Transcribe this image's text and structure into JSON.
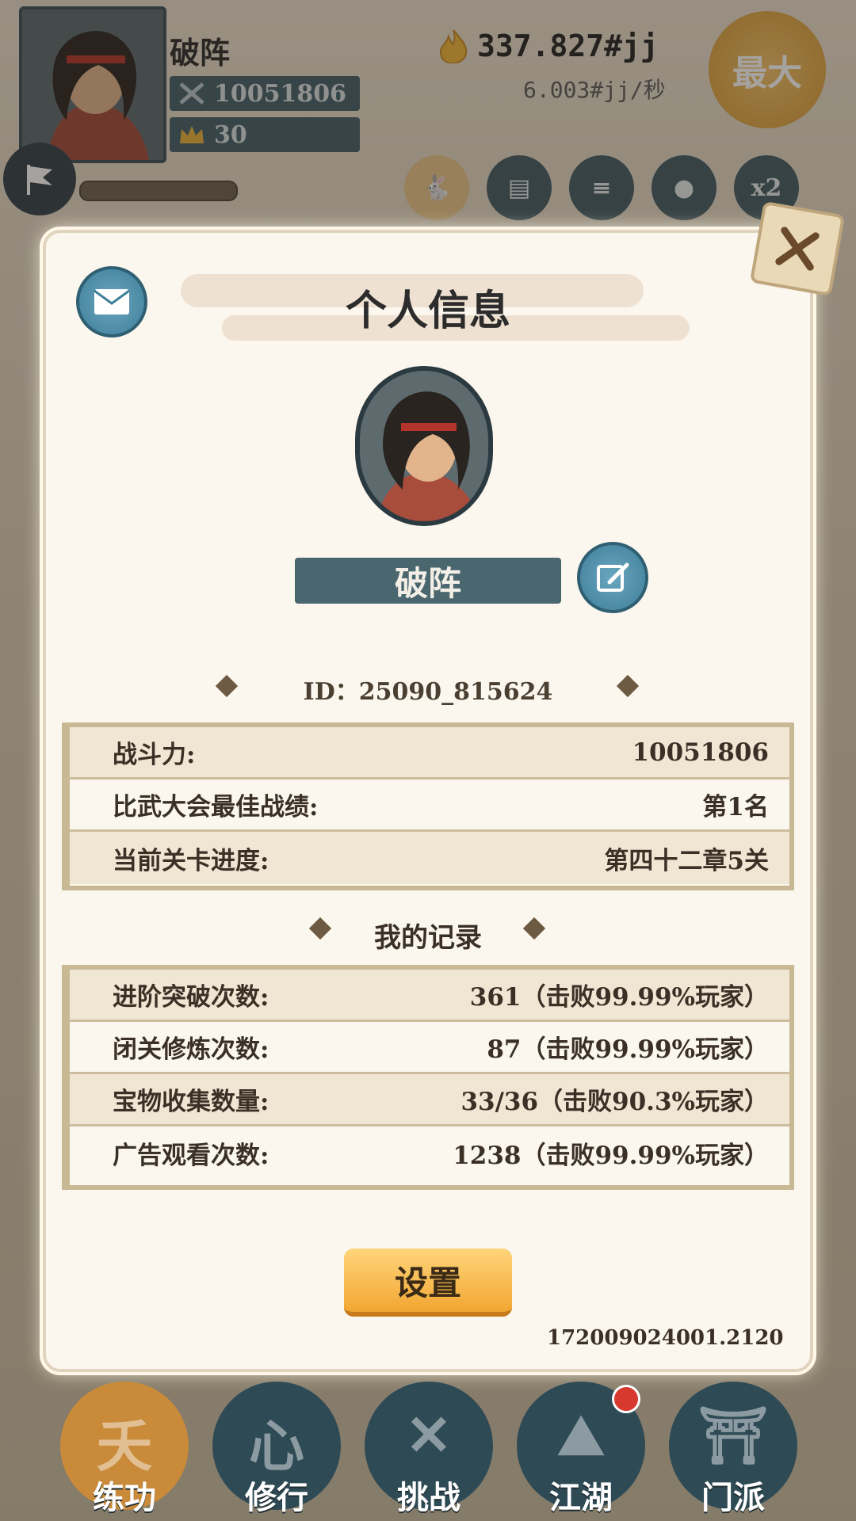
{
  "hud": {
    "player_name": "破阵",
    "power": "10051806",
    "rank": "30",
    "gold": "337.827#jj",
    "gold_rate": "6.003#jj/秒",
    "max_label": "最大",
    "icons": [
      "activity-icon",
      "profile-card-icon",
      "scroll-icon",
      "orb-icon",
      "x2-icon"
    ],
    "x2_label": "x2"
  },
  "modal": {
    "title": "个人信息",
    "name": "破阵",
    "id_line": "ID：25090_815624",
    "stats": [
      {
        "label": "战斗力:",
        "value": "10051806"
      },
      {
        "label": "比武大会最佳战绩:",
        "value": "第1名"
      },
      {
        "label": "当前关卡进度:",
        "value": "第四十二章5关"
      }
    ],
    "records_title": "我的记录",
    "records": [
      {
        "label": "进阶突破次数:",
        "value": "361（击败99.99%玩家）"
      },
      {
        "label": "闭关修炼次数:",
        "value": "87（击败99.99%玩家）"
      },
      {
        "label": "宝物收集数量:",
        "value": "33/36（击败90.3%玩家）"
      },
      {
        "label": "广告观看次数:",
        "value": "1238（击败99.99%玩家）"
      }
    ],
    "settings_label": "设置",
    "version": "172009024001.2120"
  },
  "nav": [
    {
      "label": "练功",
      "glyph": "夭",
      "active": true
    },
    {
      "label": "修行",
      "glyph": "心",
      "active": false
    },
    {
      "label": "挑战",
      "glyph": "✕",
      "active": false
    },
    {
      "label": "江湖",
      "glyph": "⛰",
      "active": false
    },
    {
      "label": "门派",
      "glyph": "⛩",
      "active": false
    }
  ],
  "colors": {
    "accent": "#4a6770",
    "button": "#f2a632",
    "panel": "#fbf7ee"
  }
}
